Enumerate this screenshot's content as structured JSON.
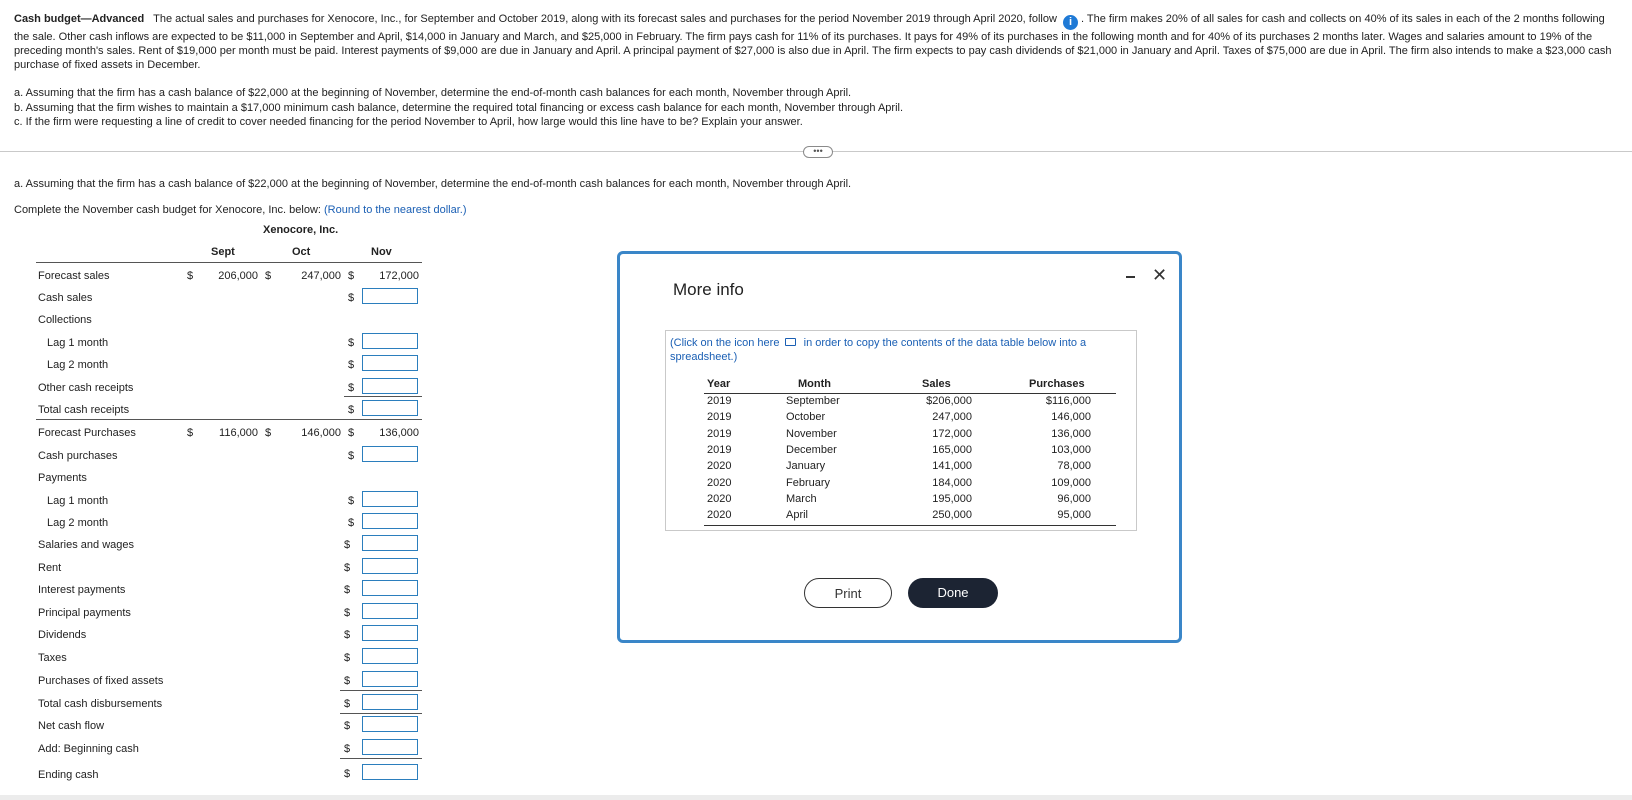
{
  "problem": {
    "title": "Cash budget—Advanced",
    "text_1": "The actual sales and purchases for Xenocore, Inc., for September and October 2019, along with its forecast sales and purchases for the period November 2019 through April 2020, follow",
    "text_2": ". The firm makes 20% of all sales for cash and collects on 40% of its sales in each of the 2 months following the sale. Other cash inflows are expected to be $11,000 in September and April, $14,000 in January and March, and $25,000 in February. The firm pays cash for 11% of its purchases. It pays for 49% of its purchases in the following month and for 40% of its purchases 2 months later. Wages and salaries amount to 19% of the preceding month's sales. Rent of $19,000 per month must be paid. Interest payments of $9,000 are due in January and April. A principal payment of $27,000 is also due in April. The firm expects to pay cash dividends of $21,000 in January and April. Taxes of $75,000 are due in April. The firm also intends to make a $23,000 cash purchase of fixed assets in December.",
    "info_icon": "i",
    "part_a": "a. Assuming that the firm has a cash balance of $22,000 at the beginning of November, determine the end-of-month cash balances for each month, November through April.",
    "part_b": "b. Assuming that the firm wishes to maintain a $17,000 minimum cash balance, determine the required total financing or excess cash balance for each month, November through April.",
    "part_c": "c. If the firm were requesting a line of credit to cover needed financing for the period November to April, how large would this line have to be? Explain your answer."
  },
  "ellipsis": "•••",
  "question": {
    "part_a": "a. Assuming that the firm has a cash balance of $22,000 at the beginning of November, determine the end-of-month cash balances for each month, November through April.",
    "instruction": "Complete the November cash budget for Xenocore, Inc. below:",
    "round_note": "(Round to the nearest dollar.)"
  },
  "budget": {
    "company": "Xenocore, Inc.",
    "columns": [
      "Sept",
      "Oct",
      "Nov"
    ],
    "dollar": "$",
    "forecast_sales": {
      "label": "Forecast sales",
      "sept": "206,000",
      "oct": "247,000",
      "nov": "172,000"
    },
    "forecast_purchases": {
      "label": "Forecast Purchases",
      "sept": "116,000",
      "oct": "146,000",
      "nov": "136,000"
    },
    "rows": {
      "cash_sales": "Cash sales",
      "collections": "Collections",
      "lag1_collections": "Lag 1 month",
      "lag2_collections": "Lag 2 month",
      "other_receipts": "Other cash receipts",
      "total_receipts": "Total cash receipts",
      "cash_purchases": "Cash purchases",
      "payments": "Payments",
      "lag1_payments": "Lag 1 month",
      "lag2_payments": "Lag 2 month",
      "salaries": "Salaries and wages",
      "rent": "Rent",
      "interest": "Interest payments",
      "principal": "Principal payments",
      "dividends": "Dividends",
      "taxes": "Taxes",
      "fixed_assets": "Purchases of fixed assets",
      "total_disbursements": "Total cash disbursements",
      "net_cash_flow": "Net cash flow",
      "beginning_cash": "Add: Beginning cash",
      "ending_cash": "Ending cash"
    }
  },
  "modal": {
    "title": "More info",
    "copy_text_1": "(Click on the icon here",
    "copy_text_2": "in order to copy the contents of the data table below into a spreadsheet.)",
    "headers": [
      "Year",
      "Month",
      "Sales",
      "Purchases"
    ],
    "rows": [
      {
        "year": "2019",
        "month": "September",
        "sales": "$206,000",
        "purchases": "$116,000"
      },
      {
        "year": "2019",
        "month": "October",
        "sales": "247,000",
        "purchases": "146,000"
      },
      {
        "year": "2019",
        "month": "November",
        "sales": "172,000",
        "purchases": "136,000"
      },
      {
        "year": "2019",
        "month": "December",
        "sales": "165,000",
        "purchases": "103,000"
      },
      {
        "year": "2020",
        "month": "January",
        "sales": "141,000",
        "purchases": "78,000"
      },
      {
        "year": "2020",
        "month": "February",
        "sales": "184,000",
        "purchases": "109,000"
      },
      {
        "year": "2020",
        "month": "March",
        "sales": "195,000",
        "purchases": "96,000"
      },
      {
        "year": "2020",
        "month": "April",
        "sales": "250,000",
        "purchases": "95,000"
      }
    ],
    "print_label": "Print",
    "done_label": "Done",
    "close_symbol": "✕"
  }
}
